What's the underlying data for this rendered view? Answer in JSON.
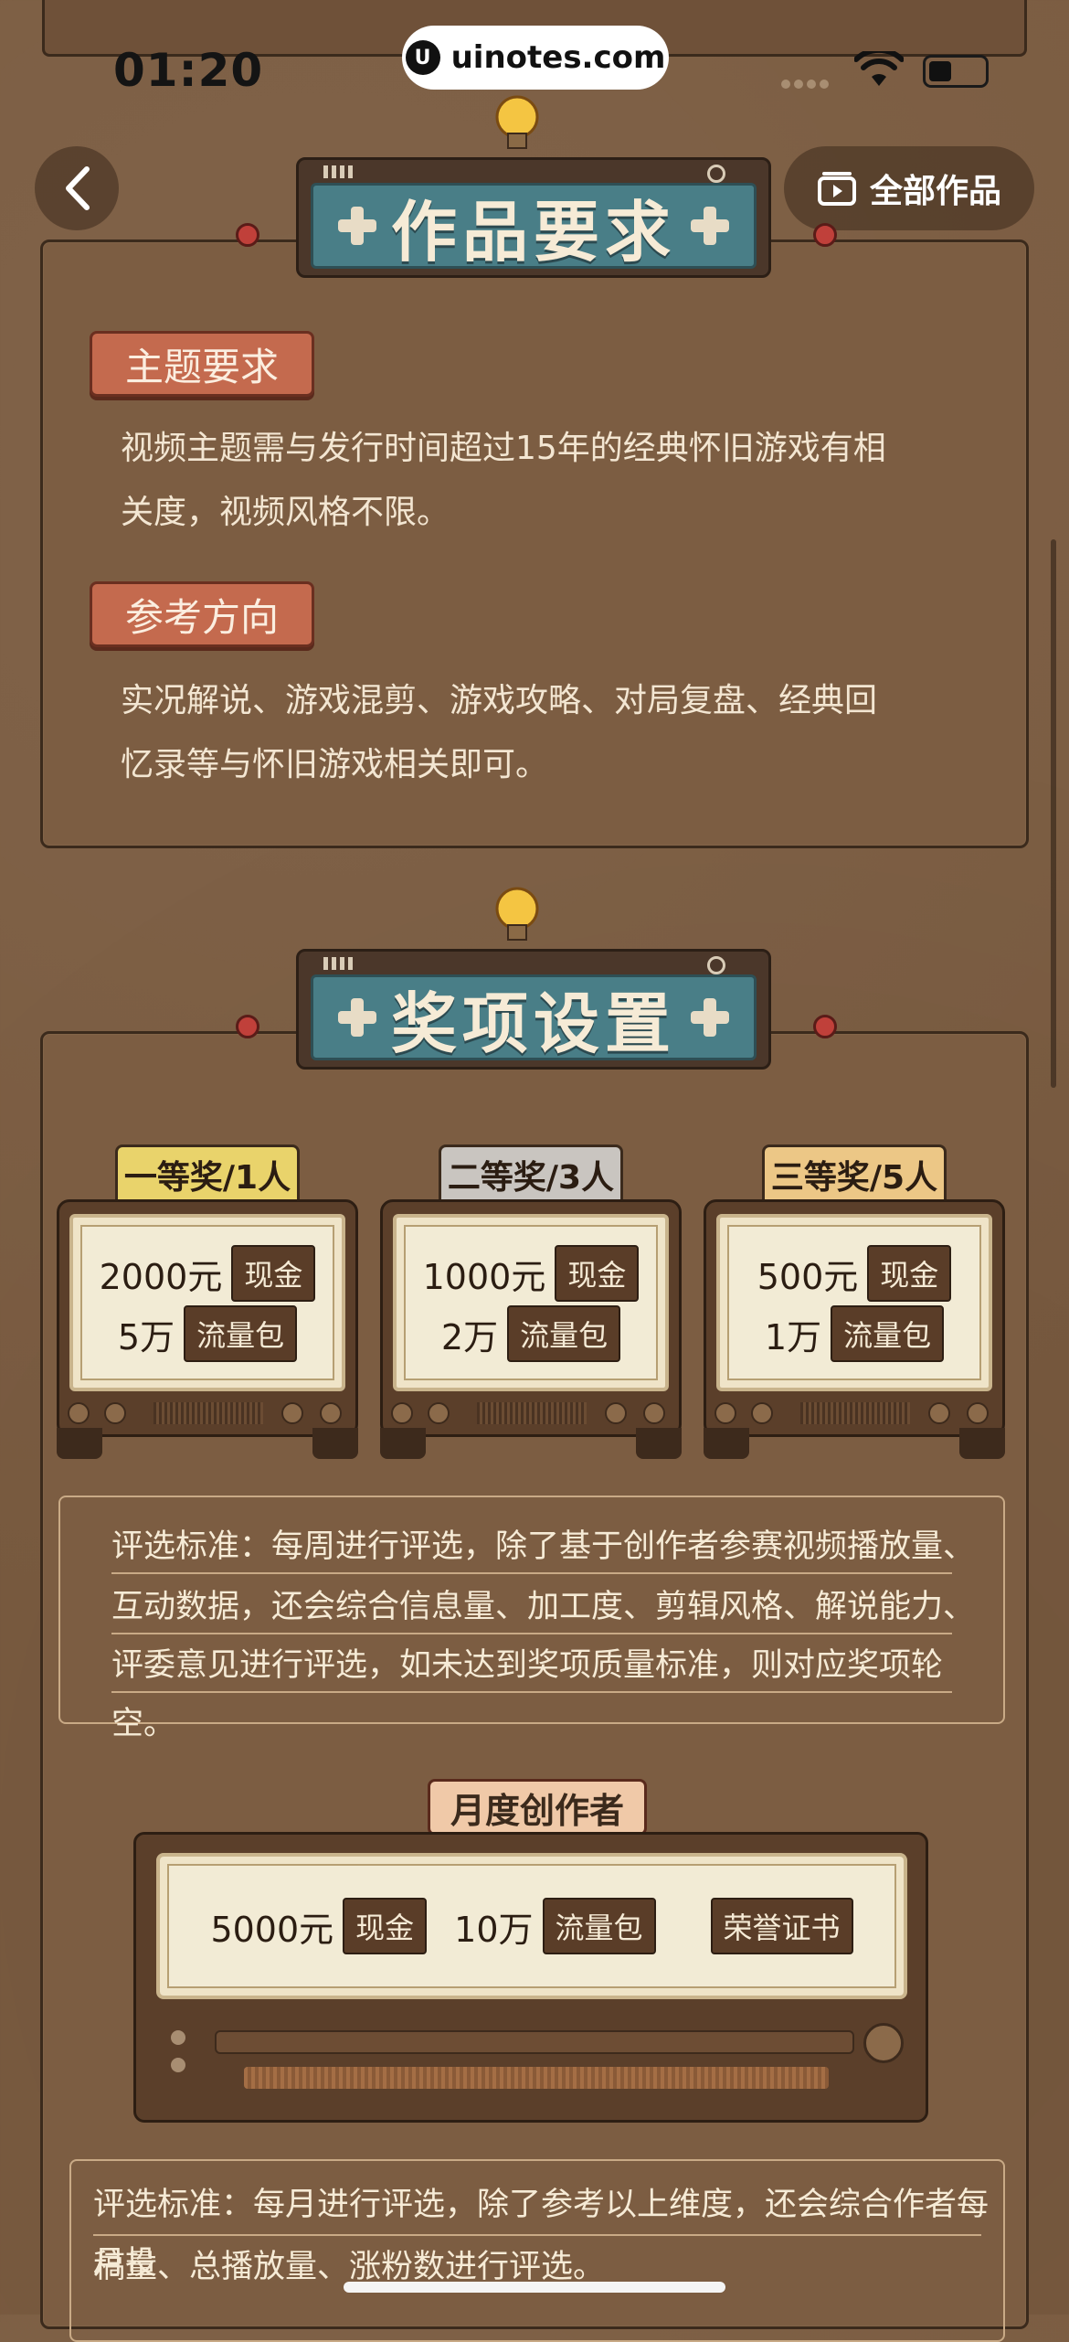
{
  "status_bar": {
    "time": "01:20",
    "watermark": "uinotes.com"
  },
  "nav": {
    "all_works_label": "全部作品"
  },
  "section_requirements": {
    "header": "作品要求",
    "theme_tag": "主题要求",
    "theme_text_1": "视频主题需与发行时间超过15年的经典怀旧游戏有相",
    "theme_text_2": "关度，视频风格不限。",
    "ref_tag": "参考方向",
    "ref_text_1": "实况解说、游戏混剪、游戏攻略、对局复盘、经典回",
    "ref_text_2": "忆录等与怀旧游戏相关即可。"
  },
  "section_awards": {
    "header": "奖项设置",
    "prizes": [
      {
        "tab": "一等奖/1人",
        "cash": "2000元",
        "cash_chip": "现金",
        "traffic": "5万",
        "traffic_chip": "流量包",
        "tab_color": "#e9d36b"
      },
      {
        "tab": "二等奖/3人",
        "cash": "1000元",
        "cash_chip": "现金",
        "traffic": "2万",
        "traffic_chip": "流量包",
        "tab_color": "#c9c5c0"
      },
      {
        "tab": "三等奖/5人",
        "cash": "500元",
        "cash_chip": "现金",
        "traffic": "1万",
        "traffic_chip": "流量包",
        "tab_color": "#ecc786"
      }
    ],
    "weekly_criteria": {
      "line1": "评选标准：每周进行评选，除了基于创作者参赛视频播放量、",
      "line2": "互动数据，还会综合信息量、加工度、剪辑风格、解说能力、",
      "line3": "评委意见进行评选，如未达到奖项质量标准，则对应奖项轮空。"
    },
    "monthly": {
      "tag": "月度创作者",
      "cash": "5000元",
      "cash_chip": "现金",
      "traffic": "10万",
      "traffic_chip": "流量包",
      "honor": "荣誉证书"
    },
    "monthly_criteria": {
      "line1": "评选标准：每月进行评选，除了参考以上维度，还会综合作者每月投",
      "line2": "稿量、总播放量、涨粉数进行评选。"
    }
  }
}
